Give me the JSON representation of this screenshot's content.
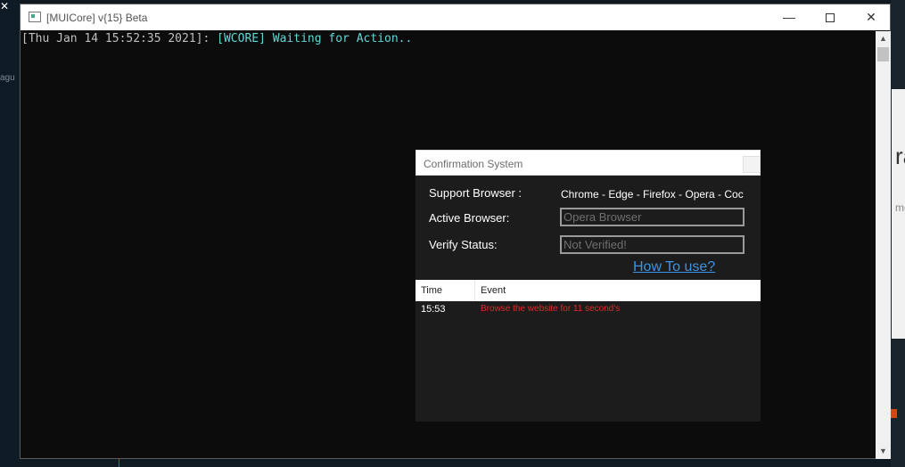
{
  "background": {
    "left_text": "agu",
    "right_text_large": "ra",
    "right_text_small": "me"
  },
  "console": {
    "title": "[MUICore] v{15} Beta",
    "log_timestamp": "[Thu Jan 14 15:52:35 2021]: ",
    "log_tag_message": "[WCORE] Waiting for Action..",
    "minimize_glyph": "—",
    "close_glyph": "✕",
    "scroll_up_glyph": "▲",
    "scroll_down_glyph": "▼"
  },
  "dialog": {
    "title": "Confirmation System",
    "support_browser_label": "Support Browser :",
    "support_browser_value": "Chrome - Edge - Firefox - Opera - Coc",
    "active_browser_label": "Active Browser:",
    "active_browser_value": "Opera Browser",
    "verify_status_label": "Verify Status:",
    "verify_status_value": "Not Verified!",
    "howto_link": "How To use?",
    "table": {
      "columns": [
        "Time",
        "Event"
      ],
      "rows": [
        {
          "time": "15:53",
          "event": "Browse the website for 11 second's"
        }
      ]
    }
  },
  "colors": {
    "console_bg": "#0c0c0c",
    "timestamp": "#bfbfbf",
    "tag": "#61d6d6",
    "link": "#3d93e6",
    "event_text": "#e02a2a"
  },
  "icons": {
    "window_icon": "console-window-icon",
    "minimize": "minimize-icon",
    "maximize": "maximize-icon",
    "close": "close-icon"
  }
}
